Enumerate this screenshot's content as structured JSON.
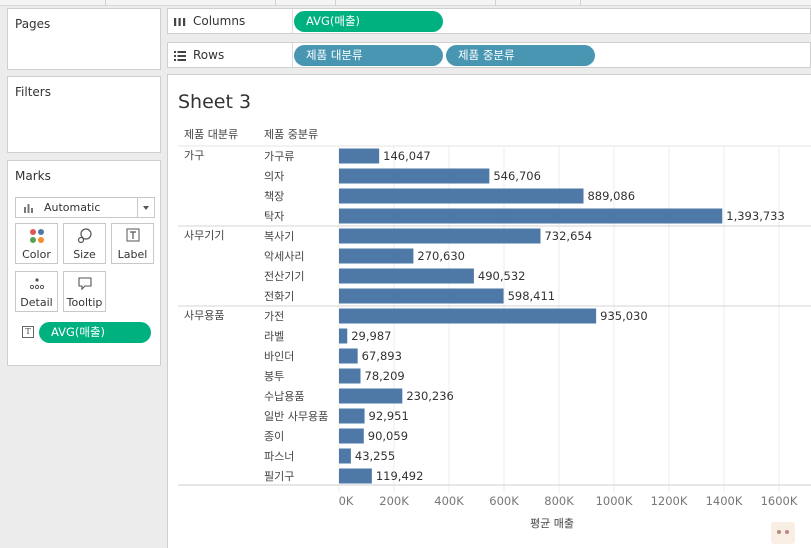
{
  "panels": {
    "pages": {
      "title": "Pages"
    },
    "filters": {
      "title": "Filters"
    },
    "marks": {
      "title": "Marks",
      "mark_type": "Automatic",
      "buttons": {
        "color": "Color",
        "size": "Size",
        "label": "Label",
        "detail": "Detail",
        "tooltip": "Tooltip"
      },
      "label_field": "AVG(매출)",
      "label_field_icon": "T"
    }
  },
  "shelves": {
    "columns": {
      "label": "Columns",
      "pills": [
        "AVG(매출)"
      ]
    },
    "rows": {
      "label": "Rows",
      "pills": [
        "제품 대분류",
        "제품 중분류"
      ]
    }
  },
  "sheet": {
    "title": "Sheet 3"
  },
  "icons": {
    "columns": "columns-icon",
    "rows": "rows-icon",
    "mark_type": "bar-chart-icon",
    "color": "color-dots-icon",
    "size": "size-circles-icon",
    "label": "text-label-icon",
    "detail": "detail-dots-icon",
    "tooltip": "tooltip-speech-icon"
  },
  "colors": {
    "bar": "#4e79a7",
    "green_pill": "#00b180",
    "blue_pill": "#4996b2"
  },
  "chart_data": {
    "type": "bar",
    "orientation": "horizontal",
    "row_headers": [
      "제품 대분류",
      "제품 중분류"
    ],
    "xlabel": "평균 매출",
    "xlim": [
      0,
      1700000
    ],
    "xticks": [
      {
        "v": 0,
        "label": "0K"
      },
      {
        "v": 200000,
        "label": "200K"
      },
      {
        "v": 400000,
        "label": "400K"
      },
      {
        "v": 600000,
        "label": "600K"
      },
      {
        "v": 800000,
        "label": "800K"
      },
      {
        "v": 1000000,
        "label": "1000K"
      },
      {
        "v": 1200000,
        "label": "1200K"
      },
      {
        "v": 1400000,
        "label": "1400K"
      },
      {
        "v": 1600000,
        "label": "1600K"
      }
    ],
    "grid": true,
    "groups": [
      {
        "name": "가구",
        "items": [
          {
            "name": "가구류",
            "value": 146047,
            "label": "146,047"
          },
          {
            "name": "의자",
            "value": 546706,
            "label": "546,706"
          },
          {
            "name": "책장",
            "value": 889086,
            "label": "889,086"
          },
          {
            "name": "탁자",
            "value": 1393733,
            "label": "1,393,733"
          }
        ]
      },
      {
        "name": "사무기기",
        "items": [
          {
            "name": "복사기",
            "value": 732654,
            "label": "732,654"
          },
          {
            "name": "악세사리",
            "value": 270630,
            "label": "270,630"
          },
          {
            "name": "전산기기",
            "value": 490532,
            "label": "490,532"
          },
          {
            "name": "전화기",
            "value": 598411,
            "label": "598,411"
          }
        ]
      },
      {
        "name": "사무용품",
        "items": [
          {
            "name": "가전",
            "value": 935030,
            "label": "935,030"
          },
          {
            "name": "라벨",
            "value": 29987,
            "label": "29,987"
          },
          {
            "name": "바인더",
            "value": 67893,
            "label": "67,893"
          },
          {
            "name": "봉투",
            "value": 78209,
            "label": "78,209"
          },
          {
            "name": "수납용품",
            "value": 230236,
            "label": "230,236"
          },
          {
            "name": "일반 사무용품",
            "value": 92951,
            "label": "92,951"
          },
          {
            "name": "종이",
            "value": 90059,
            "label": "90,059"
          },
          {
            "name": "파스너",
            "value": 43255,
            "label": "43,255"
          },
          {
            "name": "필기구",
            "value": 119492,
            "label": "119,492"
          }
        ]
      }
    ]
  }
}
